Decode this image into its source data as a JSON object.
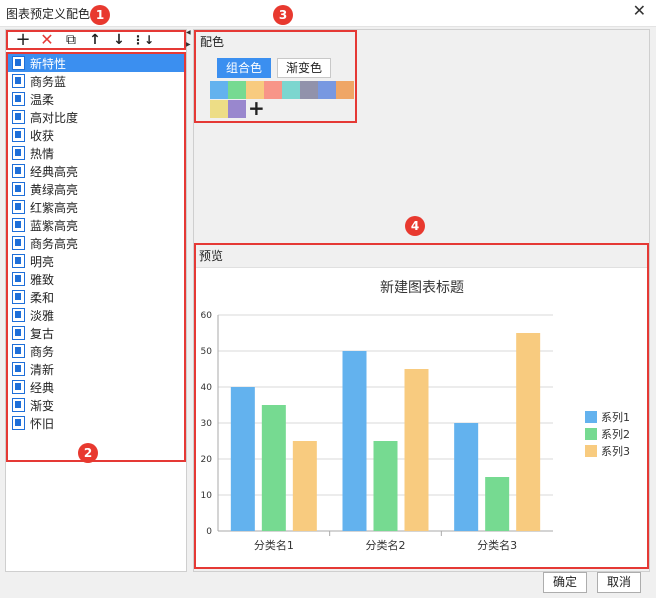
{
  "window": {
    "title": "图表预定义配色"
  },
  "markers": [
    "1",
    "2",
    "3",
    "4"
  ],
  "toolbar": {
    "add": "+",
    "delete": "✕",
    "copy": "⧉",
    "up": "↑",
    "down": "↓",
    "sort": "⋮↓"
  },
  "list": {
    "items": [
      "新特性",
      "商务蓝",
      "温柔",
      "高对比度",
      "收获",
      "热情",
      "经典高亮",
      "黄绿高亮",
      "红紫高亮",
      "蓝紫高亮",
      "商务高亮",
      "明亮",
      "雅致",
      "柔和",
      "淡雅",
      "复古",
      "商务",
      "清新",
      "经典",
      "渐变",
      "怀旧"
    ],
    "selected_index": 0
  },
  "color_section": {
    "label": "配色",
    "tabs": [
      {
        "label": "组合色",
        "active": true
      },
      {
        "label": "渐变色",
        "active": false
      }
    ],
    "swatches": [
      "#63b2ee",
      "#76da91",
      "#f8cb7f",
      "#f89588",
      "#7cd6cf",
      "#9192ab",
      "#7898e1",
      "#efa666",
      "#eddd86",
      "#9987ce"
    ],
    "add_label": "+"
  },
  "preview": {
    "label": "预览"
  },
  "chart_data": {
    "type": "bar",
    "title": "新建图表标题",
    "categories": [
      "分类名1",
      "分类名2",
      "分类名3"
    ],
    "series": [
      {
        "name": "系列1",
        "values": [
          40,
          50,
          30
        ],
        "color": "#63b2ee"
      },
      {
        "name": "系列2",
        "values": [
          35,
          25,
          15
        ],
        "color": "#76da91"
      },
      {
        "name": "系列3",
        "values": [
          25,
          45,
          55
        ],
        "color": "#f8cb7f"
      }
    ],
    "ylim": [
      0,
      60
    ],
    "yticks": [
      "0",
      "10",
      "20",
      "30",
      "40",
      "50",
      "60"
    ],
    "grid": true,
    "legend": "right"
  },
  "buttons": {
    "ok": "确定",
    "cancel": "取消"
  }
}
